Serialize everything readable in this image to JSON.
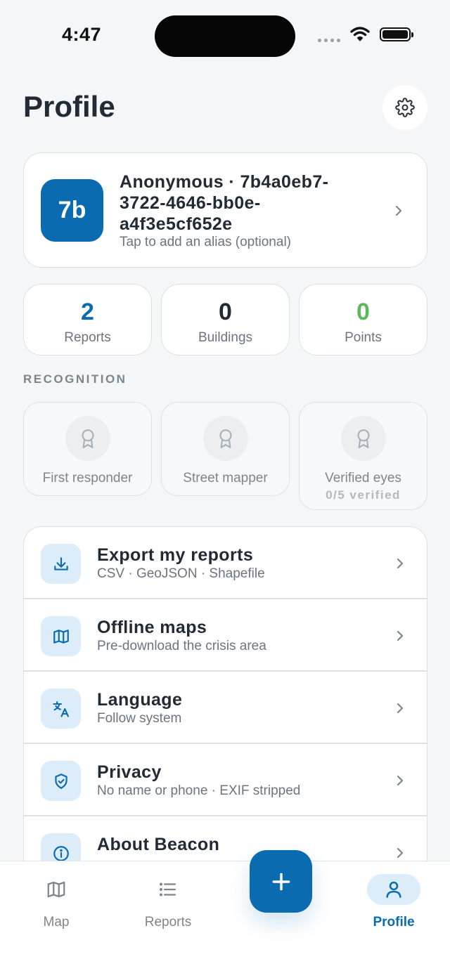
{
  "status_bar": {
    "time": "4:47"
  },
  "header": {
    "title": "Profile"
  },
  "identity": {
    "initials": "7b",
    "name": "Anonymous · 7b4a0eb7-3722-4646-bb0e-a4f3e5cf652e",
    "hint": "Tap to add an alias (optional)"
  },
  "stats": [
    {
      "value": "2",
      "label": "Reports",
      "color": "#0a6bb0"
    },
    {
      "value": "0",
      "label": "Buildings",
      "color": "#222b35"
    },
    {
      "value": "0",
      "label": "Points",
      "color": "#5cb85c"
    }
  ],
  "recognition": {
    "section_label": "RECOGNITION",
    "badges": [
      {
        "label": "First responder",
        "sub": ""
      },
      {
        "label": "Street mapper",
        "sub": ""
      },
      {
        "label": "Verified eyes",
        "sub": "0/5 verified"
      }
    ]
  },
  "settings_list": [
    {
      "icon": "download-icon",
      "title": "Export my reports",
      "subtitle": "CSV · GeoJSON · Shapefile"
    },
    {
      "icon": "map-icon",
      "title": "Offline maps",
      "subtitle": "Pre-download the crisis area"
    },
    {
      "icon": "translate-icon",
      "title": "Language",
      "subtitle": "Follow system"
    },
    {
      "icon": "shield-check-icon",
      "title": "Privacy",
      "subtitle": "No name or phone · EXIF stripped"
    },
    {
      "icon": "info-icon",
      "title": "About Beacon",
      "subtitle": ""
    }
  ],
  "tab_bar": {
    "tabs": [
      {
        "icon": "map-icon",
        "label": "Map",
        "active": false
      },
      {
        "icon": "list-icon",
        "label": "Reports",
        "active": false
      },
      {
        "icon": "person-icon",
        "label": "Profile",
        "active": true
      }
    ],
    "fab_icon": "plus-icon"
  },
  "colors": {
    "accent": "#0a6bb0",
    "accent_light": "#dcecf9",
    "background": "#f5f6f7"
  }
}
